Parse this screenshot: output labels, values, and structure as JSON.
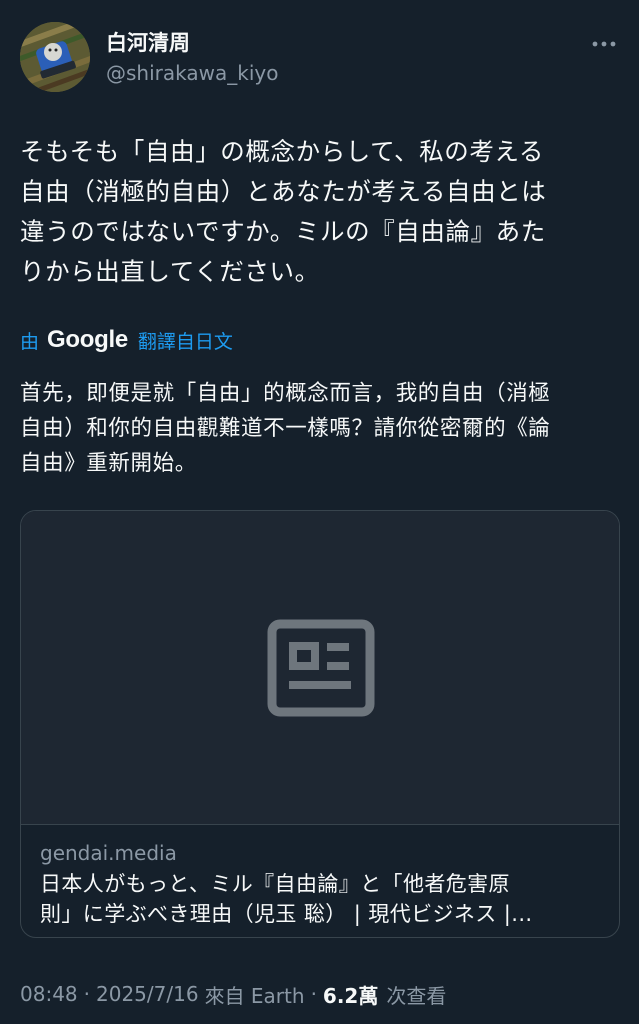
{
  "user": {
    "display_name": "白河清周",
    "handle": "@shirakawa_kiyo"
  },
  "tweet": {
    "text": "そもそも「自由」の概念からして、私の考える\n自由（消極的自由）とあなたが考える自由とは\n違うのではないですか。ミルの『自由論』あた\nりから出直してください。"
  },
  "translation": {
    "by_label": "由",
    "provider": "Google",
    "link_label": "翻譯自日文",
    "text": "首先，即便是就「自由」的概念而言，我的自由（消極\n自由）和你的自由觀難道不一樣嗎？請你從密爾的《論\n自由》重新開始。"
  },
  "link_card": {
    "domain": "gendai.media",
    "title": "日本人がもっと、ミル『自由論』と「他者危害原\n則」に学ぶべき理由（児玉 聡） | 現代ビジネス |..."
  },
  "meta": {
    "time": "08:48",
    "separator": "·",
    "date": "2025/7/16",
    "source": "來自 Earth",
    "views_count": "6.2萬",
    "views_label": "次查看"
  },
  "colors": {
    "background": "#15202b",
    "accent": "#1d9bf0",
    "secondary_text": "#8b98a5",
    "border": "#38444d"
  },
  "icons": {
    "more": "more-horizontal-icon",
    "card_placeholder": "article-icon"
  }
}
